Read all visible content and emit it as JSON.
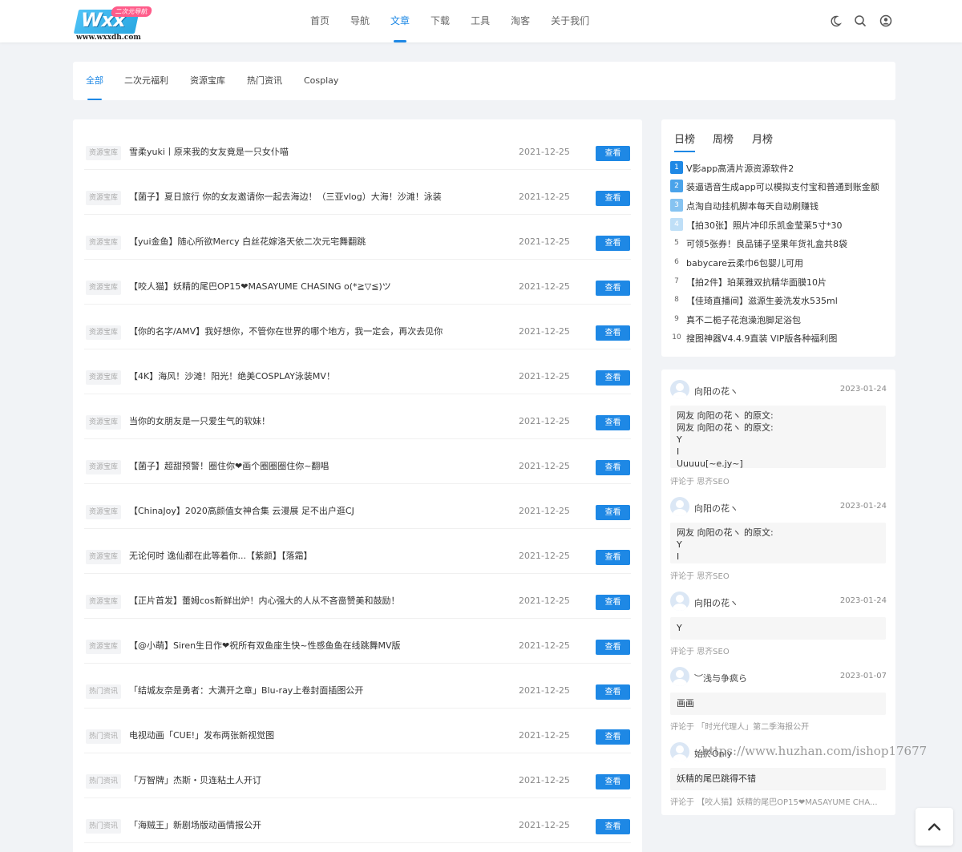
{
  "logo": {
    "mark": "Wxx",
    "tag": "二次元导航",
    "url": "www.wxxdh.com"
  },
  "nav": [
    {
      "label": "首页"
    },
    {
      "label": "导航"
    },
    {
      "label": "文章"
    },
    {
      "label": "下载"
    },
    {
      "label": "工具"
    },
    {
      "label": "淘客"
    },
    {
      "label": "关于我们"
    }
  ],
  "header_icons": [
    "moon-icon",
    "search-icon",
    "user-icon"
  ],
  "categories": [
    "全部",
    "二次元福利",
    "资源宝库",
    "热门资讯",
    "Cosplay"
  ],
  "articles": [
    {
      "tag": "资源宝库",
      "title": "雪柔yuki丨原来我的女友竟是一只女仆喵",
      "date": "2021-12-25",
      "button": "查看"
    },
    {
      "tag": "资源宝库",
      "title": "【菌子】夏日旅行 你的女友邀请你一起去海边！（三亚vlog）大海！沙滩！泳装",
      "date": "2021-12-25",
      "button": "查看"
    },
    {
      "tag": "资源宝库",
      "title": "【yui金鱼】随心所欲Mercy 白丝花嫁洛天依二次元宅舞翻跳",
      "date": "2021-12-25",
      "button": "查看"
    },
    {
      "tag": "资源宝库",
      "title": "【咬人猫】妖精的尾巴OP15❤MASAYUME CHASING o(*≧▽≦)ツ",
      "date": "2021-12-25",
      "button": "查看"
    },
    {
      "tag": "资源宝库",
      "title": "【你的名字/AMV】我好想你，不管你在世界的哪个地方，我一定会，再次去见你",
      "date": "2021-12-25",
      "button": "查看"
    },
    {
      "tag": "资源宝库",
      "title": "【4K】海风！沙滩！阳光！绝美COSPLAY泳装MV！",
      "date": "2021-12-25",
      "button": "查看"
    },
    {
      "tag": "资源宝库",
      "title": "当你的女朋友是一只爱生气的软妹！",
      "date": "2021-12-25",
      "button": "查看"
    },
    {
      "tag": "资源宝库",
      "title": "【菌子】超甜预警！圈住你❤画个圈圈圈住你~翻唱",
      "date": "2021-12-25",
      "button": "查看"
    },
    {
      "tag": "资源宝库",
      "title": "【ChinaJoy】2020高颜值女神合集 云漫展 足不出户逛CJ",
      "date": "2021-12-25",
      "button": "查看"
    },
    {
      "tag": "资源宝库",
      "title": "无论何时 逸仙都在此等着你...【紫颜】【落霜】",
      "date": "2021-12-25",
      "button": "查看"
    },
    {
      "tag": "资源宝库",
      "title": "【正片首发】蕾姆cos新鲜出炉！内心强大的人从不吝啬赞美和鼓励！",
      "date": "2021-12-25",
      "button": "查看"
    },
    {
      "tag": "资源宝库",
      "title": "【@小萌】Siren生日作❤祝所有双鱼座生快~性感鱼鱼在线跳舞MV版",
      "date": "2021-12-25",
      "button": "查看"
    },
    {
      "tag": "热门资讯",
      "title": "「结城友奈是勇者：大满开之章」Blu-ray上卷封面插图公开",
      "date": "2021-12-25",
      "button": "查看"
    },
    {
      "tag": "热门资讯",
      "title": "电视动画「CUE!」发布两张新视觉图",
      "date": "2021-12-25",
      "button": "查看"
    },
    {
      "tag": "热门资讯",
      "title": "「万智牌」杰斯・贝连粘土人开订",
      "date": "2021-12-25",
      "button": "查看"
    },
    {
      "tag": "热门资讯",
      "title": "「海贼王」新剧场版动画情报公开",
      "date": "2021-12-25",
      "button": "查看"
    }
  ],
  "ranking": {
    "tabs": [
      "日榜",
      "周榜",
      "月榜"
    ],
    "items": [
      {
        "num": "1",
        "text": "V影app高清片源资源软件2"
      },
      {
        "num": "2",
        "text": "装逼语音生成app可以模拟支付宝和普通到账金额"
      },
      {
        "num": "3",
        "text": "点淘自动挂机脚本每天自动刷赚钱"
      },
      {
        "num": "4",
        "text": "【拍30张】照片冲印乐凯金莹莱5寸*30"
      },
      {
        "num": "5",
        "text": "可领5张券！良品铺子坚果年货礼盒共8袋"
      },
      {
        "num": "6",
        "text": "babycare云柔巾6包婴儿可用"
      },
      {
        "num": "7",
        "text": "【拍2件】珀莱雅双抗精华面膜10片"
      },
      {
        "num": "8",
        "text": "【佳琦直播间】滋源生姜洗发水535ml"
      },
      {
        "num": "9",
        "text": "真不二栀子花泡澡泡脚足浴包"
      },
      {
        "num": "10",
        "text": "搜图神器V4.4.9直装 VIP版各种福利图"
      }
    ]
  },
  "comments": [
    {
      "user": "向阳の花ヽ",
      "date": "2023-01-24",
      "lines": [
        "网友 向阳の花ヽ 的原文:",
        "网友 向阳の花ヽ 的原文:",
        "Y",
        "I",
        "Uuuuu[~e.jy~]"
      ],
      "on_prefix": "评论于",
      "on_title": "思齐SEO"
    },
    {
      "user": "向阳の花ヽ",
      "date": "2023-01-24",
      "lines": [
        "网友 向阳の花ヽ 的原文:",
        "Y",
        "I"
      ],
      "on_prefix": "评论于",
      "on_title": "思齐SEO"
    },
    {
      "user": "向阳の花ヽ",
      "date": "2023-01-24",
      "lines": [
        "Y"
      ],
      "on_prefix": "评论于",
      "on_title": "思齐SEO"
    },
    {
      "user": "︶浅与争疯ら",
      "date": "2023-01-07",
      "lines": [
        "画画"
      ],
      "on_prefix": "评论于",
      "on_title": "「时光代理人」第二季海报公开"
    },
    {
      "user": "始於Only",
      "date": "",
      "lines": [
        "妖精的尾巴跳得不错"
      ],
      "on_prefix": "评论于",
      "on_title": "【咬人猫】妖精的尾巴OP15❤MASAYUME CHA..."
    }
  ],
  "watermark": "https://www.huzhan.com/ishop17677"
}
